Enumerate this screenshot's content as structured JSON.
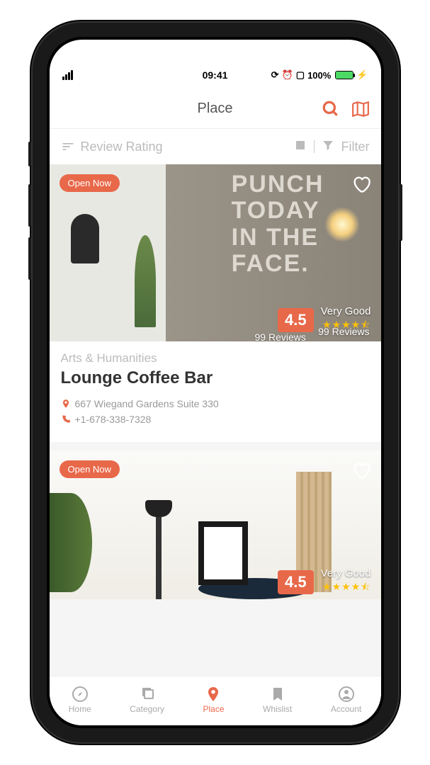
{
  "status": {
    "time": "09:41",
    "battery": "100%"
  },
  "header": {
    "title": "Place"
  },
  "sortbar": {
    "sort_label": "Review Rating",
    "filter_label": "Filter"
  },
  "cards": [
    {
      "open_badge": "Open Now",
      "rating": "4.5",
      "rating_label": "Very Good",
      "reviews": "99 Reviews",
      "category": "Arts & Humanities",
      "title": "Lounge Coffee Bar",
      "address": "667 Wiegand Gardens Suite 330",
      "phone": "+1-678-338-7328"
    },
    {
      "open_badge": "Open Now",
      "rating": "4.5",
      "rating_label": "Very Good"
    }
  ],
  "nav": {
    "home": "Home",
    "category": "Category",
    "place": "Place",
    "wishlist": "Whislist",
    "account": "Account"
  },
  "colors": {
    "accent": "#e8684a",
    "star": "#ffc107"
  }
}
